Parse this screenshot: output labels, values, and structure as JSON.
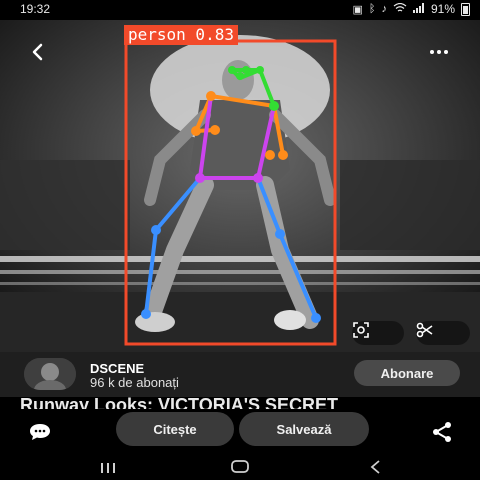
{
  "status_bar": {
    "time": "19:32",
    "battery": "91%",
    "icons": [
      "app-notification-icon",
      "bluetooth-icon",
      "mute-icon",
      "wifi-icon",
      "signal-icon",
      "battery-icon"
    ]
  },
  "detection": {
    "label": "person 0.83",
    "box_color": "#f24a2a",
    "keypoint_colors": {
      "face": "#33dd33",
      "arms": "#ff8c1a",
      "torso": "#cc44ee",
      "legs": "#3a8fff"
    }
  },
  "channel": {
    "name": "DSCENE",
    "subscribers": "96 k de abonați",
    "subscribe_label": "Abonare"
  },
  "video_title": "Runway Looks: VICTORIA'S SECRET",
  "actions": {
    "read_label": "Citește",
    "save_label": "Salvează"
  },
  "colors": {
    "background": "#000000",
    "button_bg": "#3a3a3a",
    "channel_row_bg": "#1f1f1f"
  }
}
